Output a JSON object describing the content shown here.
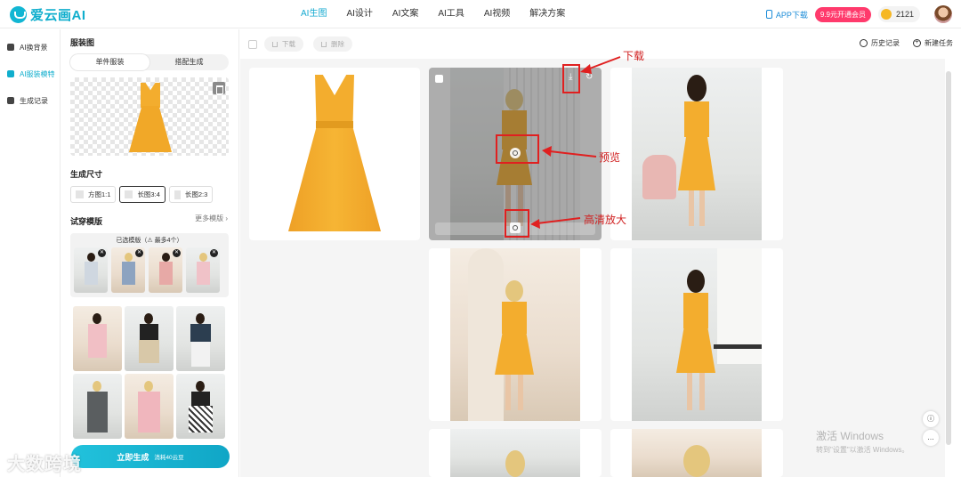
{
  "app": {
    "logo_text": "爱云画AI",
    "brand_color": "#10aecd"
  },
  "nav": {
    "items": [
      {
        "label": "AI生图",
        "active": true
      },
      {
        "label": "AI设计"
      },
      {
        "label": "AI文案"
      },
      {
        "label": "AI工具"
      },
      {
        "label": "AI视频"
      },
      {
        "label": "解决方案"
      }
    ]
  },
  "header_right": {
    "app_download": "APP下载",
    "vip_button": "9.9元开通会员",
    "coins": "2121"
  },
  "sidebar": {
    "items": [
      {
        "label": "AI换背景",
        "icon": "background-icon"
      },
      {
        "label": "AI服装模特",
        "icon": "model-icon",
        "active": true
      },
      {
        "label": "生成记录",
        "icon": "records-icon"
      }
    ]
  },
  "panel": {
    "garment_title": "服装图",
    "tabs": [
      {
        "label": "单件服装",
        "active": true
      },
      {
        "label": "搭配生成"
      }
    ],
    "size_title": "生成尺寸",
    "sizes": [
      {
        "label": "方图1:1"
      },
      {
        "label": "长图3:4",
        "active": true
      },
      {
        "label": "长图2:3"
      }
    ],
    "template_title": "试穿模版",
    "more_templates": "更多模版 ›",
    "selected_caption": "已选模版（⚠ 最多4个）",
    "generate_label": "立即生成",
    "generate_cost": "消耗40云豆"
  },
  "toolbar": {
    "download": "下载",
    "delete": "删除",
    "history": "历史记录",
    "new_task": "新建任务"
  },
  "annotations": {
    "download": "下载",
    "preview": "预览",
    "hd_upscale": "高清放大"
  },
  "watermark": {
    "line1": "激活 Windows",
    "line2": "转到\"设置\"以激活 Windows。"
  },
  "corner_watermark": "大数跨境",
  "colors": {
    "accent": "#10aecd",
    "vip": "#ff3a6c",
    "dress": "#f3ad2e",
    "annotation": "#e02020"
  }
}
